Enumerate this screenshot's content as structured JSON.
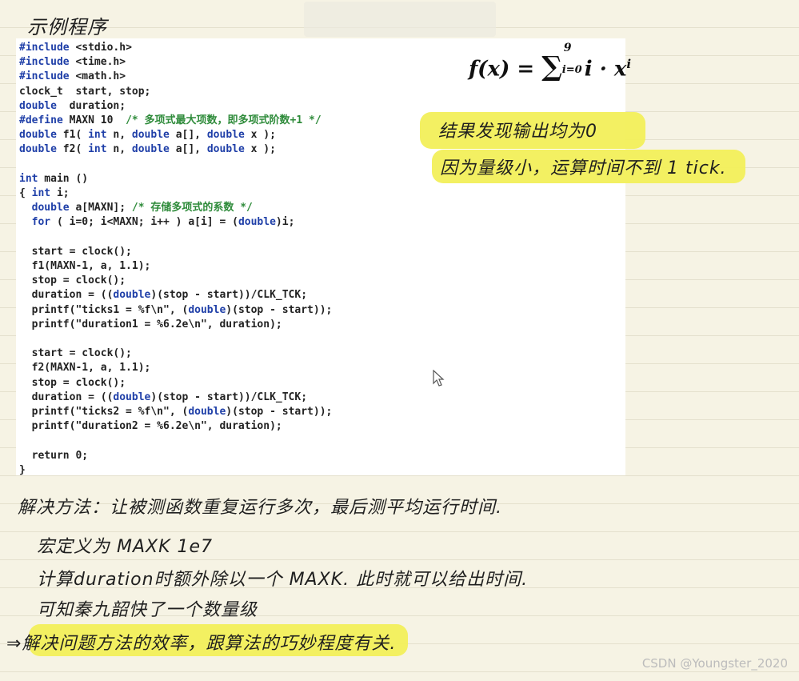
{
  "title_note": "示例程序",
  "code_lines": [
    "#include <stdio.h>",
    "#include <time.h>",
    "#include <math.h>",
    "clock_t  start, stop;",
    "double  duration;",
    "#define MAXN 10  /* 多项式最大项数，即多项式阶数+1 */",
    "double f1( int n, double a[], double x );",
    "double f2( int n, double a[], double x );",
    "",
    "int main ()",
    "{ int i;",
    "  double a[MAXN]; /* 存储多项式的系数 */",
    "  for ( i=0; i<MAXN; i++ ) a[i] = (double)i;",
    "",
    "  start = clock();",
    "  f1(MAXN-1, a, 1.1);",
    "  stop = clock();",
    "  duration = ((double)(stop - start))/CLK_TCK;",
    "  printf(\"ticks1 = %f\\n\", (double)(stop - start));",
    "  printf(\"duration1 = %6.2e\\n\", duration);",
    "",
    "  start = clock();",
    "  f2(MAXN-1, a, 1.1);",
    "  stop = clock();",
    "  duration = ((double)(stop - start))/CLK_TCK;",
    "  printf(\"ticks2 = %f\\n\", (double)(stop - start));",
    "  printf(\"duration2 = %6.2e\\n\", duration);",
    "",
    "  return 0;",
    "}"
  ],
  "formula": {
    "lhs": "f(x) = ",
    "sum": "∑",
    "upper": "9",
    "lower": "i=0",
    "term": "i · x",
    "exp": "i"
  },
  "notes_right": [
    "结果发现输出均为0",
    "因为量级小，运算时间不到 1 tick."
  ],
  "notes_bottom": [
    "解决方法：让被测函数重复运行多次，最后测平均运行时间.",
    "宏定义为 MAXK 1e7",
    "计算duration时额外除以一个 MAXK.   此时就可以给出时间.",
    "可知秦九韶快了一个数量级",
    "⇒解决问题方法的效率，跟算法的巧妙程度有关."
  ],
  "watermark": "CSDN @Youngster_2020",
  "colors": {
    "highlight": "#f2ef5a",
    "keyword": "#1f3fa8",
    "comment": "#2e8b3a",
    "paper": "#f6f3e4"
  }
}
